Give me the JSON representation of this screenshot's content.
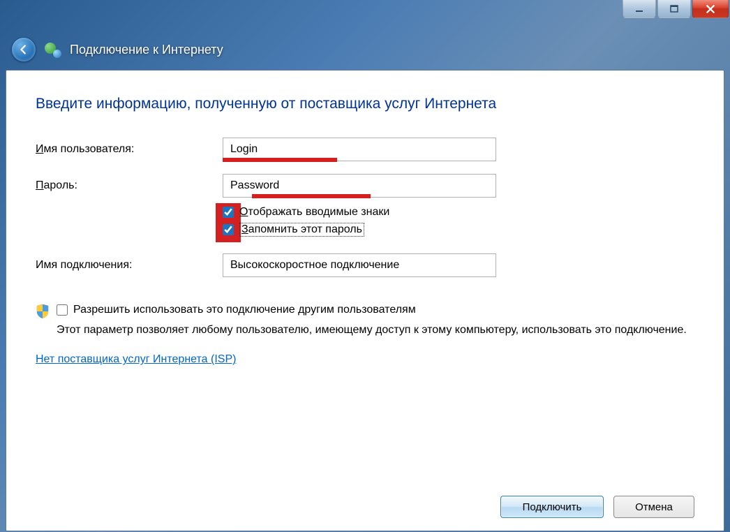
{
  "window": {
    "minimize_title": "Свернуть",
    "maximize_title": "Развернуть",
    "close_title": "Закрыть"
  },
  "header": {
    "title": "Подключение к Интернету"
  },
  "heading": "Введите информацию, полученную от поставщика услуг Интернета",
  "form": {
    "username_label_pre": "И",
    "username_label_post": "мя пользователя:",
    "username_value": "Login",
    "password_label_pre": "П",
    "password_label_post": "ароль:",
    "password_value": "Password",
    "show_chars_pre": "О",
    "show_chars_post": "тображать вводимые знаки",
    "remember_pre": "З",
    "remember_post": "апомнить этот пароль",
    "show_chars_checked": true,
    "remember_checked": true,
    "connection_name_label": "Имя подключения:",
    "connection_name_value": "Высокоскоростное подключение"
  },
  "share": {
    "checkbox_label_pre": "Р",
    "checkbox_label_post": "азрешить использовать это подключение другим пользователям",
    "checked": false,
    "description": "Этот параметр позволяет любому пользователю, имеющему доступ к этому компьютеру, использовать это подключение."
  },
  "isp_link": "Нет поставщика услуг Интернета (ISP)",
  "buttons": {
    "connect": "Подключить",
    "cancel": "Отмена"
  }
}
